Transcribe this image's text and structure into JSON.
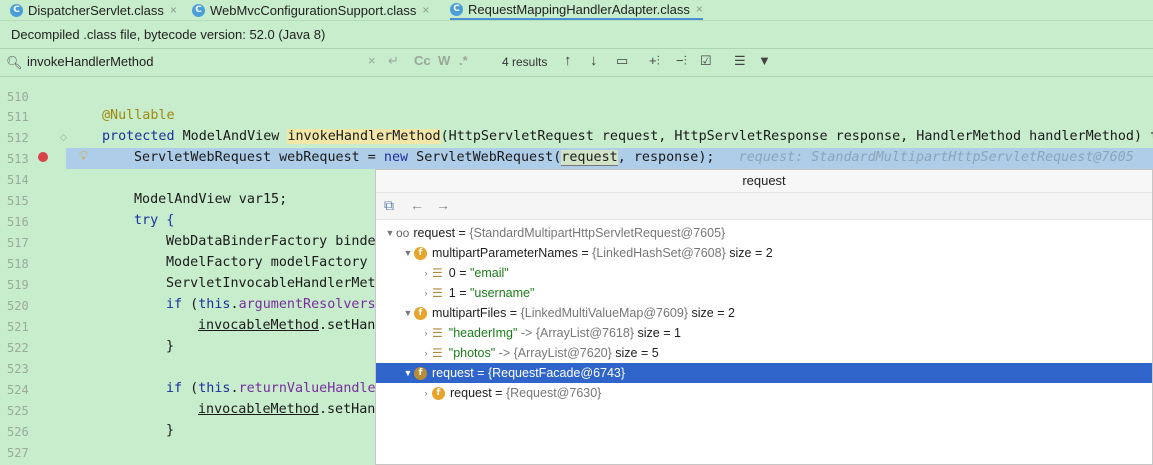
{
  "tabs": [
    {
      "icon": "C",
      "label": "DispatcherServlet.class",
      "close": "×"
    },
    {
      "icon": "C",
      "label": "WebMvcConfigurationSupport.class",
      "close": "×"
    },
    {
      "icon": "C",
      "label": "RequestMappingHandlerAdapter.class",
      "close": "×"
    }
  ],
  "banner": {
    "text": "Decompiled .class file, bytecode version: 52.0 (Java 8)"
  },
  "search": {
    "query": "invokeHandlerMethod",
    "results": "4 results",
    "match_case": "Cc",
    "words": "W",
    "regex": ".*"
  },
  "gutter": {
    "lines": [
      "510",
      "511",
      "512",
      "513",
      "514",
      "515",
      "516",
      "517",
      "518",
      "519",
      "520",
      "521",
      "522",
      "523",
      "524",
      "525",
      "526",
      "527"
    ]
  },
  "code": {
    "l511": "@Nullable",
    "l512_kw": "protected",
    "l512_a": " ModelAndView ",
    "l512_m": "invokeHandlerMethod",
    "l512_b": "(HttpServletRequest request, HttpServletResponse response, HandlerMethod handlerMethod) t",
    "l513_a": "ServletWebRequest webRequest = ",
    "l513_new": "new",
    "l513_b": " ServletWebRequest(",
    "l513_req": "request",
    "l513_c": ", response);",
    "l513_hint": "request: StandardMultipartHttpServletRequest@7605",
    "l515": "ModelAndView var15;",
    "l516": "try {",
    "l517": "WebDataBinderFactory binde",
    "l518": "ModelFactory modelFactory",
    "l519": "ServletInvocableHandlerMet",
    "l520_kw": "if",
    "l520_a": " (",
    "l520_this": "this",
    "l520_b": ".",
    "l520_f": "argumentResolvers",
    "l521_u": "invocableMethod",
    "l521_b": ".setHan",
    "l522": "}",
    "l524_kw": "if",
    "l524_a": " (",
    "l524_this": "this",
    "l524_b": ".",
    "l524_f": "returnValueHandle",
    "l525_u": "invocableMethod",
    "l525_b": ".setHan",
    "l526": "}"
  },
  "popup": {
    "title": "request",
    "rows": [
      {
        "name": "request",
        "value": "{StandardMultipartHttpServletRequest@7605}"
      },
      {
        "name": "multipartParameterNames",
        "value": "{LinkedHashSet@7608}",
        "extra": "size = 2"
      },
      {
        "name": "0",
        "value": "\"email\""
      },
      {
        "name": "1",
        "value": "\"username\""
      },
      {
        "name": "multipartFiles",
        "value": "{LinkedMultiValueMap@7609}",
        "extra": "size = 2"
      },
      {
        "name": "\"headerImg\"",
        "arrow": "->",
        "value": "{ArrayList@7618}",
        "extra": "size = 1"
      },
      {
        "name": "\"photos\"",
        "arrow": "->",
        "value": "{ArrayList@7620}",
        "extra": "size = 5"
      },
      {
        "name": "request",
        "value": "{RequestFacade@6743}"
      },
      {
        "name": "request",
        "value": "{Request@7630}"
      }
    ],
    "eq": " = "
  }
}
